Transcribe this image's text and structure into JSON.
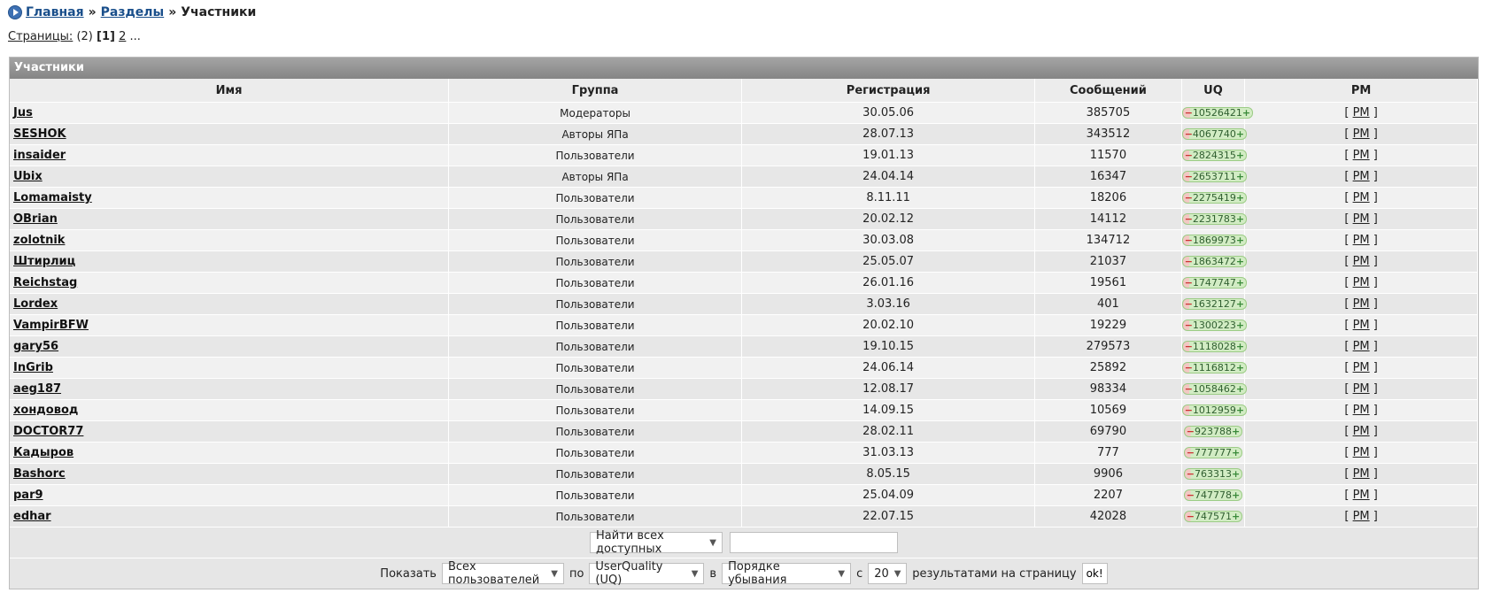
{
  "breadcrumb": {
    "home": "Главная",
    "sections": "Разделы",
    "current": "Участники",
    "sep": "»"
  },
  "pages": {
    "label": "Страницы:",
    "count": "(2)",
    "current": "[1]",
    "next": "2",
    "more": "..."
  },
  "panel": {
    "title": "Участники"
  },
  "table": {
    "headers": [
      "Имя",
      "Группа",
      "Регистрация",
      "Сообщений",
      "UQ",
      "PM"
    ],
    "rows": [
      {
        "name": "Jus",
        "group": "Модераторы",
        "reg": "30.05.06",
        "posts": "385705",
        "uq": "10526421"
      },
      {
        "name": "SESHOK",
        "group": "Авторы ЯПа",
        "reg": "28.07.13",
        "posts": "343512",
        "uq": "4067740"
      },
      {
        "name": "insaider",
        "group": "Пользователи",
        "reg": "19.01.13",
        "posts": "11570",
        "uq": "2824315"
      },
      {
        "name": "Ubix",
        "group": "Авторы ЯПа",
        "reg": "24.04.14",
        "posts": "16347",
        "uq": "2653711"
      },
      {
        "name": "Lomamaisty",
        "group": "Пользователи",
        "reg": "8.11.11",
        "posts": "18206",
        "uq": "2275419"
      },
      {
        "name": "OBrian",
        "group": "Пользователи",
        "reg": "20.02.12",
        "posts": "14112",
        "uq": "2231783"
      },
      {
        "name": "zolotnik",
        "group": "Пользователи",
        "reg": "30.03.08",
        "posts": "134712",
        "uq": "1869973"
      },
      {
        "name": "Штирлиц",
        "group": "Пользователи",
        "reg": "25.05.07",
        "posts": "21037",
        "uq": "1863472"
      },
      {
        "name": "Reichstag",
        "group": "Пользователи",
        "reg": "26.01.16",
        "posts": "19561",
        "uq": "1747747"
      },
      {
        "name": "Lordex",
        "group": "Пользователи",
        "reg": "3.03.16",
        "posts": "401",
        "uq": "1632127"
      },
      {
        "name": "VampirBFW",
        "group": "Пользователи",
        "reg": "20.02.10",
        "posts": "19229",
        "uq": "1300223"
      },
      {
        "name": "gary56",
        "group": "Пользователи",
        "reg": "19.10.15",
        "posts": "279573",
        "uq": "1118028"
      },
      {
        "name": "InGrib",
        "group": "Пользователи",
        "reg": "24.06.14",
        "posts": "25892",
        "uq": "1116812"
      },
      {
        "name": "aeg187",
        "group": "Пользователи",
        "reg": "12.08.17",
        "posts": "98334",
        "uq": "1058462"
      },
      {
        "name": "хондовод",
        "group": "Пользователи",
        "reg": "14.09.15",
        "posts": "10569",
        "uq": "1012959"
      },
      {
        "name": "DOCTOR77",
        "group": "Пользователи",
        "reg": "28.02.11",
        "posts": "69790",
        "uq": "923788"
      },
      {
        "name": "Кадыров",
        "group": "Пользователи",
        "reg": "31.03.13",
        "posts": "777",
        "uq": "777777"
      },
      {
        "name": "Bashorc",
        "group": "Пользователи",
        "reg": "8.05.15",
        "posts": "9906",
        "uq": "763313"
      },
      {
        "name": "par9",
        "group": "Пользователи",
        "reg": "25.04.09",
        "posts": "2207",
        "uq": "747778"
      },
      {
        "name": "edhar",
        "group": "Пользователи",
        "reg": "22.07.15",
        "posts": "42028",
        "uq": "747571"
      }
    ],
    "pm_label": "PM"
  },
  "search": {
    "mode": "Найти всех доступных",
    "query": ""
  },
  "filter": {
    "show_label": "Показать",
    "users": "Всех пользователей",
    "by_label": "по",
    "sort_field": "UserQuality (UQ)",
    "in_label": "в",
    "order": "Порядке убывания",
    "with_label": "с",
    "per_page": "20",
    "per_page_label": "результатами на страницу",
    "ok": "ok!"
  }
}
